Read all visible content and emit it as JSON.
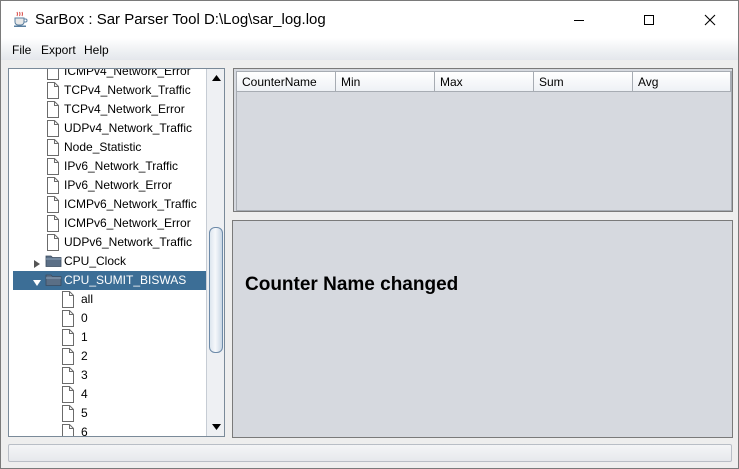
{
  "window": {
    "title": "SarBox : Sar Parser Tool D:\\Log\\sar_log.log",
    "app_icon": "java-cup-icon",
    "controls": [
      "minimize-icon",
      "maximize-icon",
      "close-icon"
    ]
  },
  "menu": {
    "items": [
      {
        "label": "File"
      },
      {
        "label": "Export"
      },
      {
        "label": "Help"
      }
    ]
  },
  "tree": {
    "nodes": [
      {
        "label": "ICMPv4_Network_Error",
        "type": "leaf"
      },
      {
        "label": "TCPv4_Network_Traffic",
        "type": "leaf"
      },
      {
        "label": "TCPv4_Network_Error",
        "type": "leaf"
      },
      {
        "label": "UDPv4_Network_Traffic",
        "type": "leaf"
      },
      {
        "label": "Node_Statistic",
        "type": "leaf"
      },
      {
        "label": "IPv6_Network_Traffic",
        "type": "leaf"
      },
      {
        "label": "IPv6_Network_Error",
        "type": "leaf"
      },
      {
        "label": "ICMPv6_Network_Traffic",
        "type": "leaf"
      },
      {
        "label": "ICMPv6_Network_Error",
        "type": "leaf"
      },
      {
        "label": "UDPv6_Network_Traffic",
        "type": "leaf"
      },
      {
        "label": "CPU_Clock",
        "type": "folder",
        "expanded": false
      },
      {
        "label": "CPU_SUMIT_BISWAS",
        "type": "folder",
        "expanded": true,
        "selected": true
      },
      {
        "label": "all",
        "type": "leaf"
      },
      {
        "label": "0",
        "type": "leaf"
      },
      {
        "label": "1",
        "type": "leaf"
      },
      {
        "label": "2",
        "type": "leaf"
      },
      {
        "label": "3",
        "type": "leaf"
      },
      {
        "label": "4",
        "type": "leaf"
      },
      {
        "label": "5",
        "type": "leaf"
      },
      {
        "label": "6",
        "type": "leaf"
      }
    ]
  },
  "table": {
    "columns": [
      "CounterName",
      "Min",
      "Max",
      "Sum",
      "Avg"
    ],
    "rows": []
  },
  "message": {
    "text": "Counter Name changed"
  },
  "colors": {
    "selection": "#3c6e96",
    "panel_bg": "#d6d9df",
    "client_bg": "#eeeeee"
  }
}
